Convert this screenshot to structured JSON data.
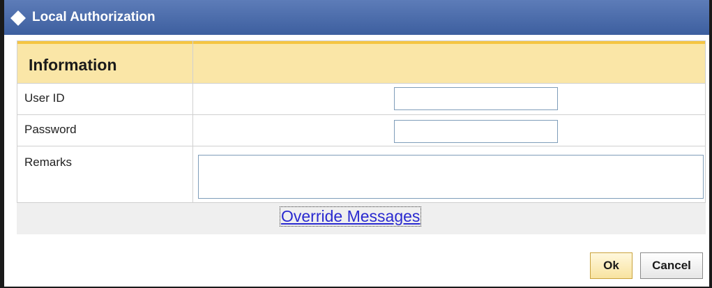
{
  "dialog": {
    "title": "Local Authorization",
    "title_icon": "diamond-icon"
  },
  "form": {
    "section_label": "Information",
    "fields": [
      {
        "label": "User ID",
        "value": ""
      },
      {
        "label": "Password",
        "value": ""
      },
      {
        "label": "Remarks",
        "value": ""
      }
    ],
    "override_link": "Override Messages"
  },
  "buttons": {
    "ok_label": "Ok",
    "cancel_label": "Cancel"
  },
  "colors": {
    "titlebar": "#4a6aab",
    "header_fill": "#fae6a7",
    "header_accent": "#f5c542",
    "link": "#2a2ad0"
  }
}
